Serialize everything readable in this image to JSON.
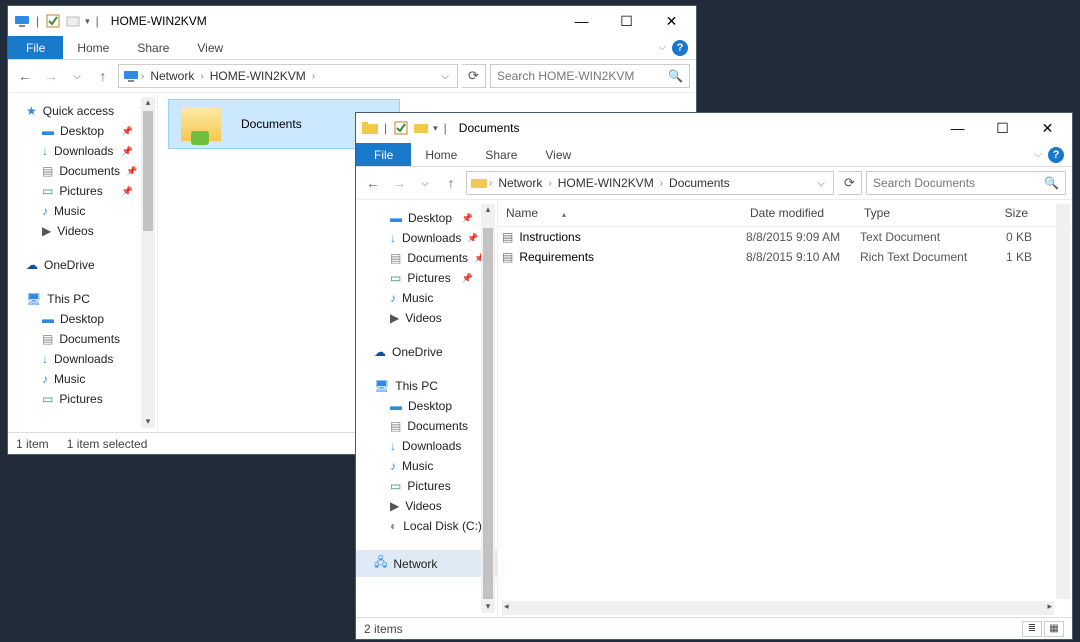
{
  "win1": {
    "title": "HOME-WIN2KVM",
    "ribbon": {
      "file": "File",
      "home": "Home",
      "share": "Share",
      "view": "View"
    },
    "crumbs": [
      "Network",
      "HOME-WIN2KVM"
    ],
    "search_placeholder": "Search HOME-WIN2KVM",
    "nav": {
      "quick_access": "Quick access",
      "items_qa": [
        "Desktop",
        "Downloads",
        "Documents",
        "Pictures",
        "Music",
        "Videos"
      ],
      "onedrive": "OneDrive",
      "thispc": "This PC",
      "items_pc": [
        "Desktop",
        "Documents",
        "Downloads",
        "Music",
        "Pictures"
      ]
    },
    "tile_label": "Documents",
    "status_left": "1 item",
    "status_sel": "1 item selected"
  },
  "win2": {
    "title": "Documents",
    "ribbon": {
      "file": "File",
      "home": "Home",
      "share": "Share",
      "view": "View"
    },
    "crumbs": [
      "Network",
      "HOME-WIN2KVM",
      "Documents"
    ],
    "search_placeholder": "Search Documents",
    "cols": {
      "name": "Name",
      "date": "Date modified",
      "type": "Type",
      "size": "Size"
    },
    "rows": [
      {
        "name": "Instructions",
        "date": "8/8/2015 9:09 AM",
        "type": "Text Document",
        "size": "0 KB"
      },
      {
        "name": "Requirements",
        "date": "8/8/2015 9:10 AM",
        "type": "Rich Text Document",
        "size": "1 KB"
      }
    ],
    "nav": {
      "items_qa": [
        "Desktop",
        "Downloads",
        "Documents",
        "Pictures",
        "Music",
        "Videos"
      ],
      "onedrive": "OneDrive",
      "thispc": "This PC",
      "items_pc": [
        "Desktop",
        "Documents",
        "Downloads",
        "Music",
        "Pictures",
        "Videos",
        "Local Disk (C:)"
      ],
      "network": "Network"
    },
    "status": "2 items"
  }
}
